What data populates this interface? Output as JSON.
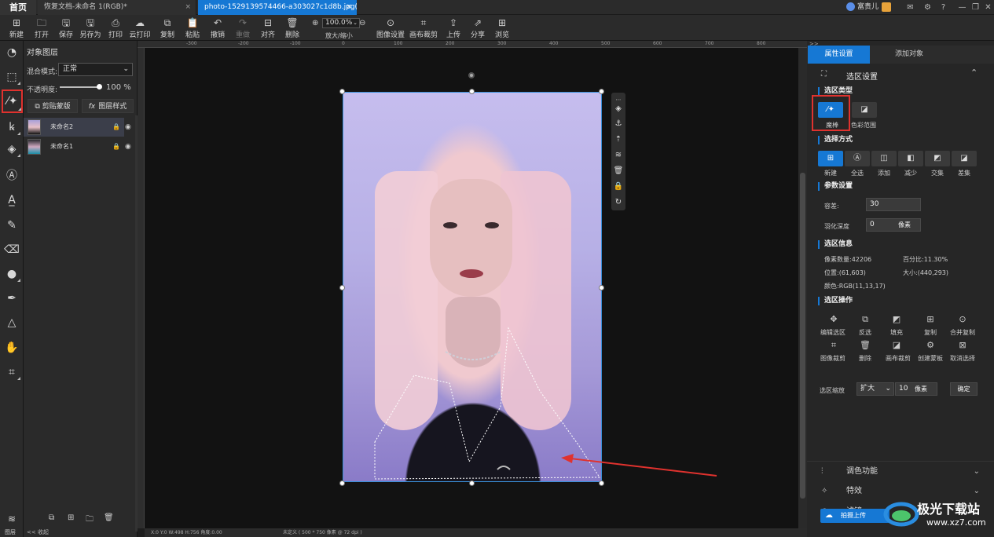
{
  "tabs": {
    "home": "首页",
    "tab1": "恢复文档-未命名 1(RGB)*",
    "tab2": "photo-1529139574466-a303027c1d8b.jpg(R...",
    "close": "×"
  },
  "user": {
    "name": "富贵儿"
  },
  "toolbar": {
    "new": "新建",
    "open": "打开",
    "save": "保存",
    "save_as": "另存为",
    "print": "打印",
    "cloud_print": "云打印",
    "copy": "复制",
    "paste": "粘贴",
    "undo": "撤销",
    "redo": "重做",
    "align": "对齐",
    "delete": "删除",
    "zoom_value": "100.0%",
    "zoom_label": "放大/缩小",
    "image_settings": "图像设置",
    "canvas_crop": "画布裁剪",
    "upload": "上传",
    "share": "分享",
    "browse": "浏览"
  },
  "layers_panel": {
    "title": "对象图层",
    "blend_label": "混合模式:",
    "blend_value": "正常",
    "opacity_label": "不透明度:",
    "opacity_value": "100",
    "opacity_unit": "%",
    "opacity_fraction": 1.0,
    "clip_mask": "剪贴蒙版",
    "layer_style": "图层样式",
    "fx": "fx",
    "layers": [
      {
        "name": "未命名2",
        "selected": true
      },
      {
        "name": "未命名1",
        "selected": false
      }
    ],
    "bottom_label": "图层",
    "collapse_label": "<< 收起"
  },
  "ruler_ticks": [
    "-300",
    "-200",
    "-100",
    "0",
    "100",
    "200",
    "300",
    "400",
    "500",
    "600",
    "700",
    "800"
  ],
  "status": {
    "coords": "X:0 Y:0 W:498 H:756 角度:0.00",
    "doc_info": "未定义 ( 500 * 750 像素 @ 72 dpi )"
  },
  "right_panel": {
    "tab_properties": "属性设置",
    "tab_add_object": "添加对象",
    "header": "选区设置",
    "sel_type_title": "选区类型",
    "magic_wand": "魔棒",
    "color_range": "色彩范围",
    "sel_mode_title": "选择方式",
    "modes": [
      "新建",
      "全选",
      "添加",
      "减少",
      "交集",
      "差集"
    ],
    "params_title": "参数设置",
    "tolerance_label": "容差:",
    "tolerance_value": "30",
    "feather_label": "羽化深度",
    "feather_value": "0",
    "feather_unit": "像素",
    "info_title": "选区信息",
    "pixel_count": "像素数量:42206",
    "percent": "百分比:11.30%",
    "position": "位置:(61,603)",
    "size": "大小:(440,293)",
    "color": "颜色:RGB(11,13,17)",
    "ops_title": "选区操作",
    "ops_row1": [
      "编辑选区",
      "反选",
      "填充",
      "复制",
      "合并复制"
    ],
    "ops_row2": [
      "图像裁剪",
      "删除",
      "画布裁剪",
      "创建蒙板",
      "取消选择"
    ],
    "scale_label": "选区缩放",
    "scale_mode": "扩大",
    "scale_value": "10",
    "scale_unit": "像素",
    "confirm": "确定",
    "adjust": "调色功能",
    "effects": "特效",
    "filter": "滤镜"
  },
  "upload_bubble": "拍摄上传",
  "watermark": {
    "name": "极光下载站",
    "url": "www.xz7.com"
  },
  "colors": {
    "accent": "#1678d4",
    "highlight": "#e0322e",
    "panel": "#262626",
    "canvas": "#121212"
  }
}
